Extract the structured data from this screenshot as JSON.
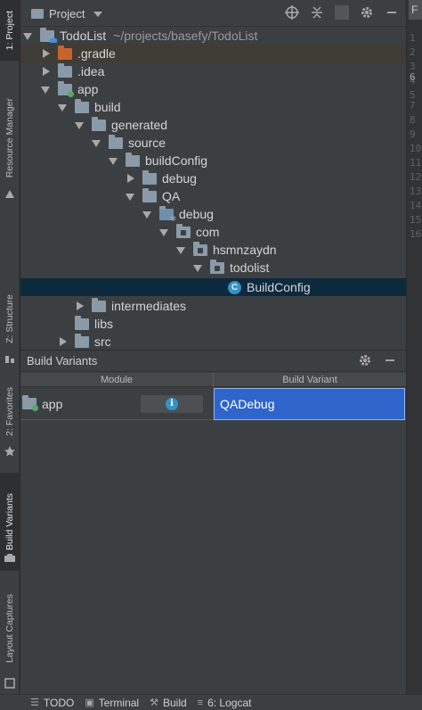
{
  "left_tabs": [
    {
      "label": "1: Project",
      "active": true
    },
    {
      "label": "Resource Manager",
      "active": false
    },
    {
      "label": "Z: Structure",
      "active": false
    },
    {
      "label": "2: Favorites",
      "active": false
    },
    {
      "label": "Build Variants",
      "active": true
    },
    {
      "label": "Layout Captures",
      "active": false
    }
  ],
  "project_panel": {
    "title": "Project",
    "tree": [
      {
        "label": "TodoList",
        "path": "~/projects/basefy/TodoList",
        "state": "expanded",
        "depth": 0
      },
      {
        "label": ".gradle",
        "state": "collapsed",
        "depth": 1,
        "folder": "orange",
        "highlighted": true
      },
      {
        "label": ".idea",
        "state": "collapsed",
        "depth": 1
      },
      {
        "label": "app",
        "state": "expanded",
        "depth": 1,
        "module": true
      },
      {
        "label": "build",
        "state": "expanded",
        "depth": 2
      },
      {
        "label": "generated",
        "state": "expanded",
        "depth": 3
      },
      {
        "label": "source",
        "state": "expanded",
        "depth": 4
      },
      {
        "label": "buildConfig",
        "state": "expanded",
        "depth": 5
      },
      {
        "label": "debug",
        "state": "collapsed",
        "depth": 6
      },
      {
        "label": "QA",
        "state": "expanded",
        "depth": 6
      },
      {
        "label": "debug",
        "state": "expanded",
        "depth": 7,
        "source_root": true
      },
      {
        "label": "com",
        "state": "expanded",
        "depth": 8,
        "package": true
      },
      {
        "label": "hsmnzaydn",
        "state": "expanded",
        "depth": 9,
        "package": true
      },
      {
        "label": "todolist",
        "state": "expanded",
        "depth": 10,
        "package": true
      },
      {
        "label": "BuildConfig",
        "state": "leaf",
        "depth": 11,
        "class": true,
        "selected": true
      },
      {
        "label": "intermediates",
        "state": "collapsed",
        "depth": 3
      },
      {
        "label": "libs",
        "state": "none",
        "depth": 2
      },
      {
        "label": "src",
        "state": "collapsed",
        "depth": 2
      }
    ]
  },
  "editor_gutter": {
    "tab": "F",
    "lines": [
      "1",
      "2",
      "3",
      "4",
      "5",
      "6",
      "7",
      "8",
      "9",
      "10",
      "11",
      "12",
      "13",
      "14",
      "15",
      "16"
    ]
  },
  "build_variants": {
    "title": "Build Variants",
    "columns": {
      "module": "Module",
      "variant": "Build Variant"
    },
    "rows": [
      {
        "module": "app",
        "variant": "QADebug"
      }
    ]
  },
  "bottom_tabs": [
    {
      "label": "TODO",
      "icon": "list-icon"
    },
    {
      "label": "Terminal",
      "icon": "terminal-icon"
    },
    {
      "label": "Build",
      "icon": "hammer-icon"
    },
    {
      "label": "6: Logcat",
      "icon": "logcat-icon"
    }
  ],
  "colors": {
    "selection": "#0d293e",
    "variant_selected": "#2f65ca",
    "gradle_folder": "#c9632e",
    "class_icon": "#3592c4",
    "module_dot": "#59a869"
  }
}
